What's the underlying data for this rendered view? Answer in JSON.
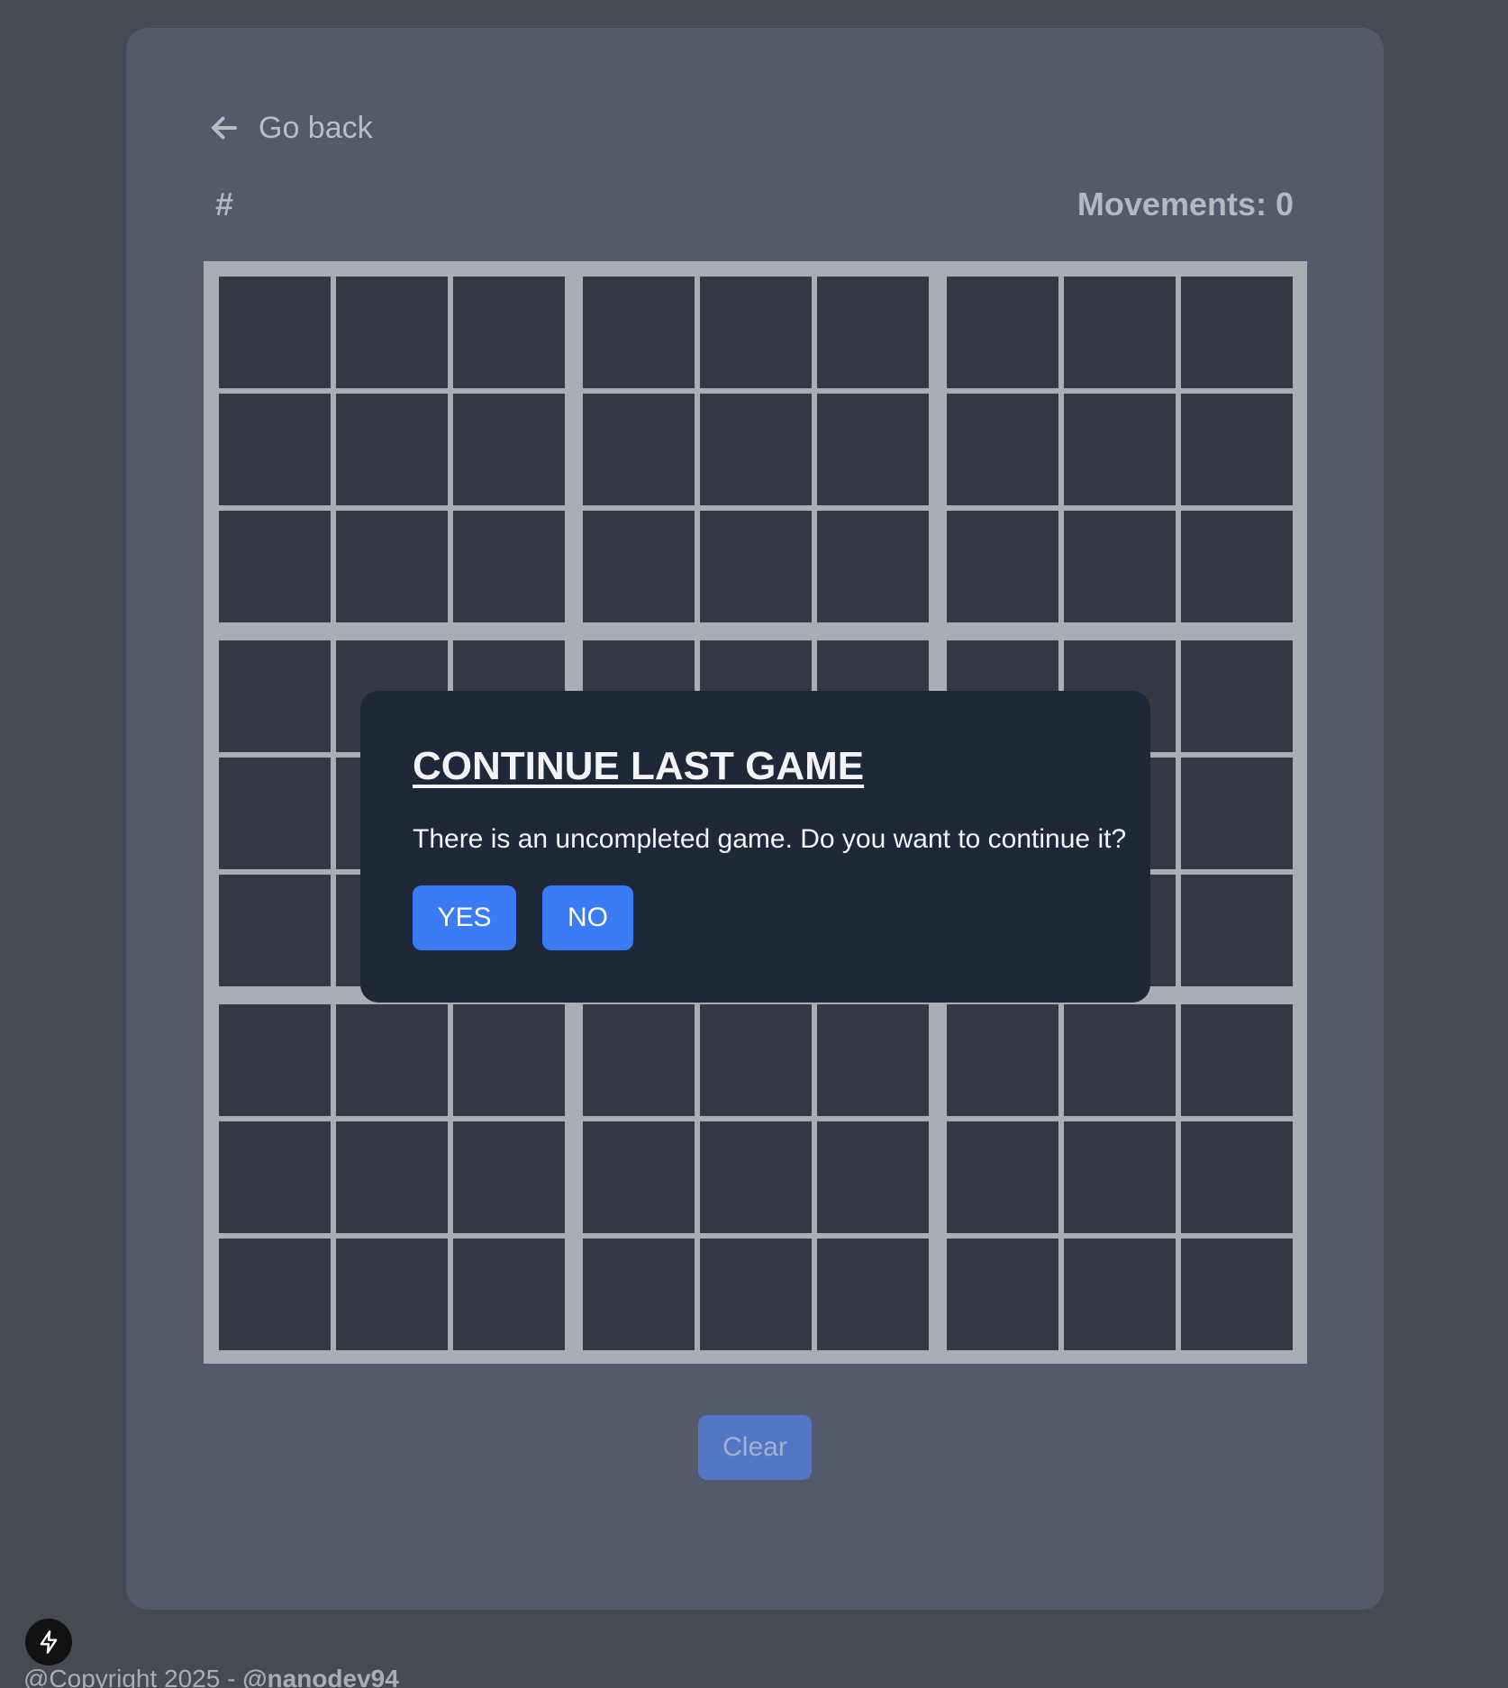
{
  "nav": {
    "back_label": "Go back",
    "back_icon": "arrow-left-icon"
  },
  "header": {
    "game_id": "#",
    "movements_label": "Movements: 0",
    "movements": 0
  },
  "board": {
    "size": 9,
    "cells": []
  },
  "actions": {
    "clear_label": "Clear"
  },
  "modal": {
    "title": "CONTINUE LAST GAME",
    "message": "There is an uncompleted game. Do you want to continue it?",
    "yes_label": "YES",
    "no_label": "NO"
  },
  "footer": {
    "copyright": "@Copyright 2025 - ",
    "author": "@nanodev94"
  },
  "badge": {
    "icon": "lightning-bolt-icon"
  },
  "colors": {
    "page_bg": "#454a53",
    "card_bg": "#535a6b",
    "cell_bg": "#353842",
    "grid_line": "#a9adb4",
    "modal_bg": "#1f2839",
    "accent": "#3b7bf6"
  }
}
